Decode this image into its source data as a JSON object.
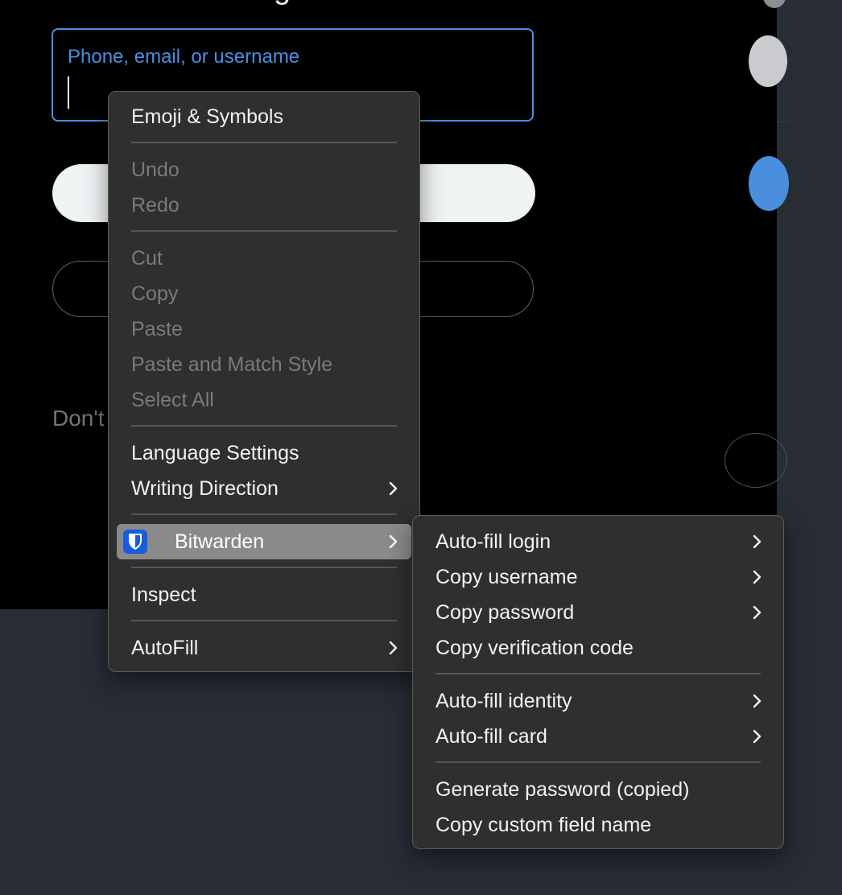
{
  "login_form": {
    "heading_fragment": "g",
    "identifier_placeholder": "Phone, email, or username",
    "footer_text_fragment": "Don't"
  },
  "context_menu": {
    "items": {
      "emoji": "Emoji & Symbols",
      "undo": "Undo",
      "redo": "Redo",
      "cut": "Cut",
      "copy": "Copy",
      "paste": "Paste",
      "paste_match": "Paste and Match Style",
      "select_all": "Select All",
      "language_settings": "Language Settings",
      "writing_direction": "Writing Direction",
      "bitwarden": "Bitwarden",
      "inspect": "Inspect",
      "autofill": "AutoFill"
    }
  },
  "bitwarden_submenu": {
    "items": {
      "autofill_login": "Auto-fill login",
      "copy_username": "Copy username",
      "copy_password": "Copy password",
      "copy_verification_code": "Copy verification code",
      "autofill_identity": "Auto-fill identity",
      "autofill_card": "Auto-fill card",
      "generate_password": "Generate password (copied)",
      "copy_custom_field_name": "Copy custom field name"
    }
  },
  "icons": {
    "chevron": "chevron-right-icon",
    "bitwarden": "bitwarden-shield-icon"
  },
  "colors": {
    "accent_blue": "#4a90e2",
    "menu_bg": "#2f2f2f",
    "highlight": "#8a8a8a",
    "bitwarden_blue": "#175ddc"
  }
}
